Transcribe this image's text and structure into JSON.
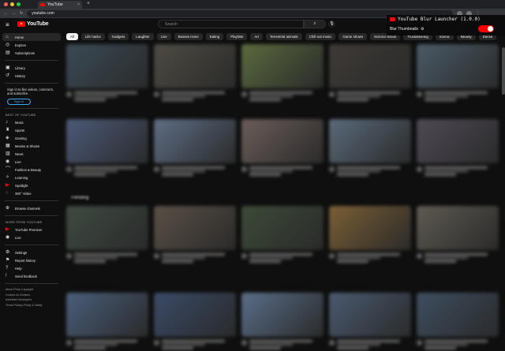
{
  "browser": {
    "tab_title": "YouTube",
    "url": "youtube.com",
    "dot_colors": [
      "#ff5f57",
      "#febc2e",
      "#28c840"
    ]
  },
  "header": {
    "logo_text": "YouTube",
    "search_placeholder": "Search",
    "sign_in_label": "Sign in"
  },
  "sidebar": {
    "main": [
      {
        "label": "Home",
        "icon": "home-icon"
      },
      {
        "label": "Explore",
        "icon": "compass-icon"
      },
      {
        "label": "Subscriptions",
        "icon": "subscriptions-icon"
      }
    ],
    "library": [
      {
        "label": "Library",
        "icon": "library-icon"
      },
      {
        "label": "History",
        "icon": "history-icon"
      }
    ],
    "signin_note": "Sign in to like videos, comment, and subscribe.",
    "signin_button": "Sign in",
    "best_header": "BEST OF YOUTUBE",
    "best": [
      {
        "label": "Music",
        "icon": "music-icon"
      },
      {
        "label": "Sports",
        "icon": "trophy-icon"
      },
      {
        "label": "Gaming",
        "icon": "gamepad-icon"
      },
      {
        "label": "Movies & Shows",
        "icon": "film-icon"
      },
      {
        "label": "News",
        "icon": "news-icon"
      },
      {
        "label": "Live",
        "icon": "live-icon"
      },
      {
        "label": "Fashion & Beauty",
        "icon": "hanger-icon"
      },
      {
        "label": "Learning",
        "icon": "lightbulb-icon"
      },
      {
        "label": "Spotlight",
        "icon": "youtube-icon"
      },
      {
        "label": "360° Video",
        "icon": "video-360-icon"
      }
    ],
    "browse": {
      "label": "Browse channels",
      "icon": "plus-circle-icon"
    },
    "more_header": "MORE FROM YOUTUBE",
    "more": [
      {
        "label": "YouTube Premium",
        "icon": "youtube-icon"
      },
      {
        "label": "Live",
        "icon": "live-icon"
      }
    ],
    "settings": [
      {
        "label": "Settings",
        "icon": "gear-icon"
      },
      {
        "label": "Report history",
        "icon": "flag-icon"
      },
      {
        "label": "Help",
        "icon": "help-icon"
      },
      {
        "label": "Send feedback",
        "icon": "feedback-icon"
      }
    ],
    "footer": [
      "About  Press  Copyright",
      "Contact us  Creators",
      "Advertise  Developers",
      "Terms  Privacy  Policy & Safety"
    ]
  },
  "chips": [
    "All",
    "Life hacks",
    "Gadgets",
    "Laughter",
    "Live",
    "Bosses Hone",
    "Eating",
    "Playlists",
    "Art",
    "Terrestrial animals",
    "Chill-out music",
    "Game shows",
    "Science fiction",
    "Trucksteering",
    "Scenic",
    "Beauty",
    "Dance"
  ],
  "section_title": "Trending",
  "extension": {
    "title": "YouTube Blur Launcher (1.0.0)",
    "setting_label": "Blur Thumbnails",
    "toggle_on": true,
    "accent": "#ff0000"
  }
}
